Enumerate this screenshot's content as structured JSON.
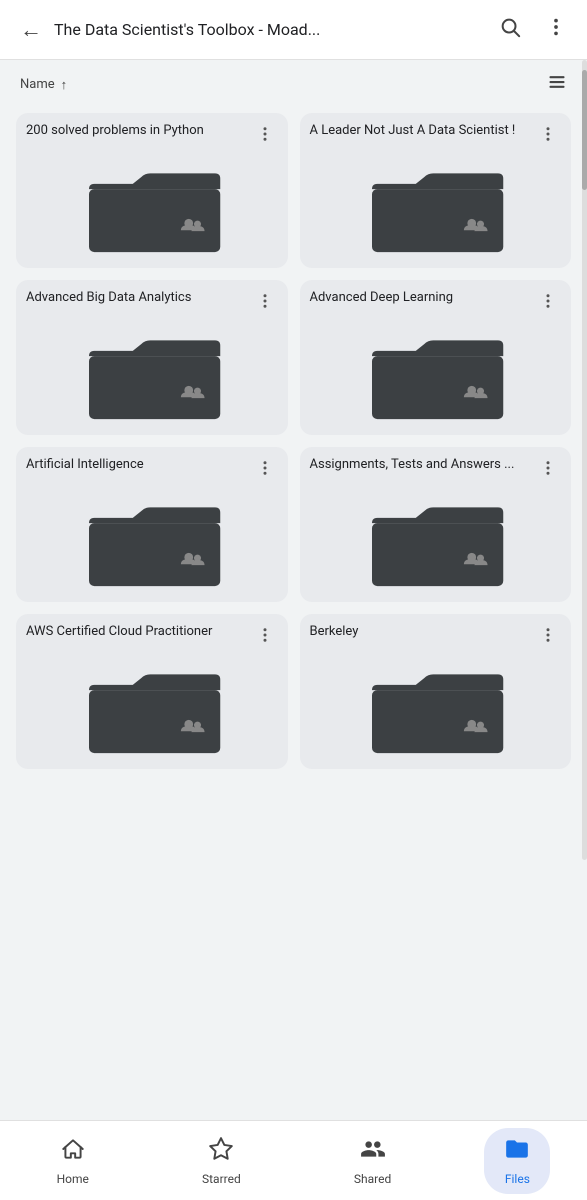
{
  "header": {
    "title": "The Data Scientist's Toolbox - Moad...",
    "back_label": "←",
    "search_icon": "search",
    "more_icon": "more_vert"
  },
  "sort": {
    "label": "Name",
    "direction": "↑",
    "list_view_icon": "list"
  },
  "folders": [
    {
      "id": 1,
      "name": "200 solved problems in Python",
      "shared": true
    },
    {
      "id": 2,
      "name": "A Leader Not Just A Data Scientist !",
      "shared": true
    },
    {
      "id": 3,
      "name": "Advanced Big Data Analytics",
      "shared": true
    },
    {
      "id": 4,
      "name": "Advanced Deep Learning",
      "shared": true
    },
    {
      "id": 5,
      "name": "Artificial Intelligence",
      "shared": true
    },
    {
      "id": 6,
      "name": "Assignments, Tests and Answers ...",
      "shared": true
    },
    {
      "id": 7,
      "name": "AWS  Certified Cloud Practitioner",
      "shared": true
    },
    {
      "id": 8,
      "name": "Berkeley",
      "shared": true
    }
  ],
  "nav": {
    "items": [
      {
        "id": "home",
        "label": "Home",
        "icon": "home",
        "active": false
      },
      {
        "id": "starred",
        "label": "Starred",
        "icon": "star",
        "active": false
      },
      {
        "id": "shared",
        "label": "Shared",
        "icon": "people",
        "active": false
      },
      {
        "id": "files",
        "label": "Files",
        "icon": "folder",
        "active": true
      }
    ]
  },
  "colors": {
    "folder_bg": "#e8eaed",
    "folder_icon": "#3c4043",
    "accent": "#1a73e8",
    "active_nav_bg": "#e3e8f8"
  }
}
